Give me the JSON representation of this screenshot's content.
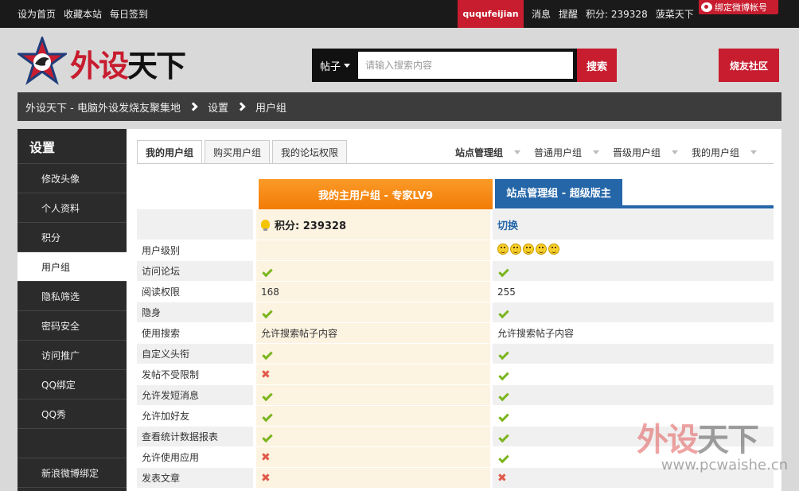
{
  "topbar": {
    "links": [
      "设为首页",
      "收藏本站",
      "每日签到"
    ],
    "username": "ququfeijian",
    "right": [
      "消息",
      "提醒",
      "积分: 239328",
      "菠菜天下"
    ],
    "weibo_bind": "绑定微博帐号"
  },
  "header": {
    "logo_red": "外设",
    "logo_black": "天下",
    "search_category": "帖子",
    "search_placeholder": "请输入搜索内容",
    "search_button": "搜索",
    "community_button": "烧友社区"
  },
  "breadcrumb": [
    "外设天下 - 电脑外设发烧友聚集地",
    "设置",
    "用户组"
  ],
  "sidebar": {
    "title": "设置",
    "items": [
      "修改头像",
      "个人资料",
      "积分",
      "用户组",
      "隐私筛选",
      "密码安全",
      "访问推广",
      "QQ绑定",
      "QQ秀",
      "新浪微博绑定"
    ],
    "active_index": 3
  },
  "tabs": [
    "我的用户组",
    "购买用户组",
    "我的论坛权限"
  ],
  "dropnav": [
    "站点管理组",
    "普通用户组",
    "晋级用户组",
    "我的用户组"
  ],
  "columns": {
    "primary": "我的主用户组 - 专家LV9",
    "secondary": "站点管理组 - 超级版主"
  },
  "head_row": {
    "credits_label": "积分: 239328",
    "switch_label": "切换"
  },
  "rows": [
    {
      "label": "用户级别",
      "a": "",
      "b": "smileys"
    },
    {
      "label": "访问论坛",
      "a": "check",
      "b": "check"
    },
    {
      "label": "阅读权限",
      "a": "168",
      "b": "255"
    },
    {
      "label": "隐身",
      "a": "check",
      "b": "check"
    },
    {
      "label": "使用搜索",
      "a": "允许搜索帖子内容",
      "b": "允许搜索帖子内容"
    },
    {
      "label": "自定义头衔",
      "a": "check",
      "b": "check"
    },
    {
      "label": "发帖不受限制",
      "a": "cross",
      "b": "check"
    },
    {
      "label": "允许发短消息",
      "a": "check",
      "b": "check"
    },
    {
      "label": "允许加好友",
      "a": "check",
      "b": "check"
    },
    {
      "label": "查看统计数据报表",
      "a": "check",
      "b": "check"
    },
    {
      "label": "允许使用应用",
      "a": "cross",
      "b": "check"
    },
    {
      "label": "发表文章",
      "a": "cross",
      "b": "cross"
    }
  ],
  "watermark": {
    "logo_red": "外设",
    "logo_black": "天下",
    "url": "www.pcwaishe.cn"
  },
  "colors": {
    "brand_red": "#c71d2f",
    "accent_orange": "#f27c06",
    "accent_blue": "#2466a8",
    "check_green": "#7ab51d",
    "cross_red": "#e0594a"
  }
}
